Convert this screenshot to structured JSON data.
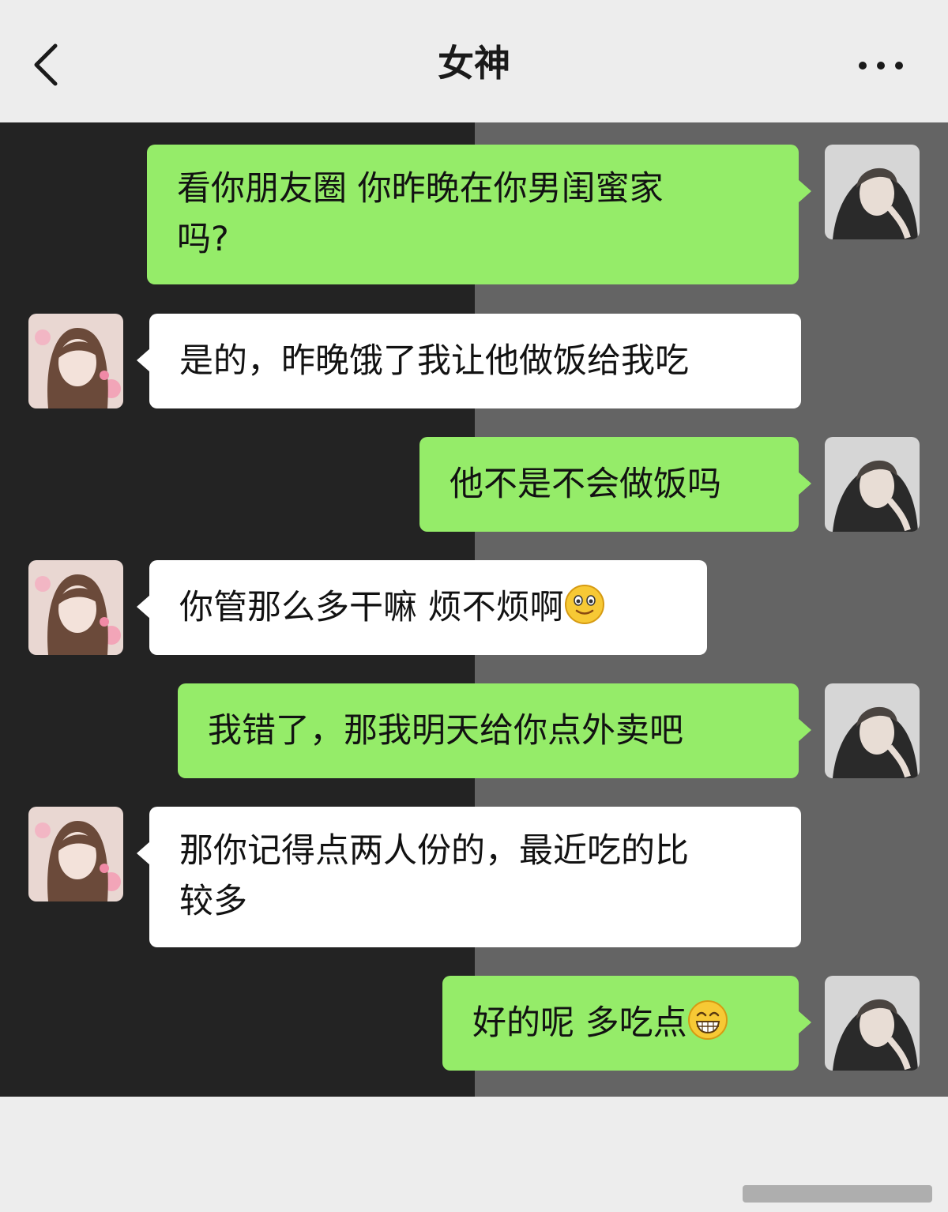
{
  "header": {
    "title": "女神",
    "back_icon": "chevron-left-icon",
    "more_icon": "more-icon"
  },
  "colors": {
    "header_bg": "#ededed",
    "chat_bg_left": "#232323",
    "chat_bg_right": "#646464",
    "outgoing_bubble": "#95ec69",
    "incoming_bubble": "#ffffff"
  },
  "messages": [
    {
      "sender": "me",
      "lines": [
        "看你朋友圈 你昨晚在你男闺蜜家",
        "吗?"
      ]
    },
    {
      "sender": "her",
      "lines": [
        "是的，昨晚饿了我让他做饭给我吃"
      ]
    },
    {
      "sender": "me",
      "lines": [
        "他不是不会做饭吗"
      ]
    },
    {
      "sender": "her",
      "lines": [
        "你管那么多干嘛 烦不烦啊"
      ],
      "emoji": "smile-emoji"
    },
    {
      "sender": "me",
      "lines": [
        "我错了，那我明天给你点外卖吧"
      ]
    },
    {
      "sender": "her",
      "lines": [
        "那你记得点两人份的，最近吃的比",
        "较多"
      ]
    },
    {
      "sender": "me",
      "lines": [
        "好的呢 多吃点"
      ],
      "emoji": "grin-emoji"
    }
  ]
}
